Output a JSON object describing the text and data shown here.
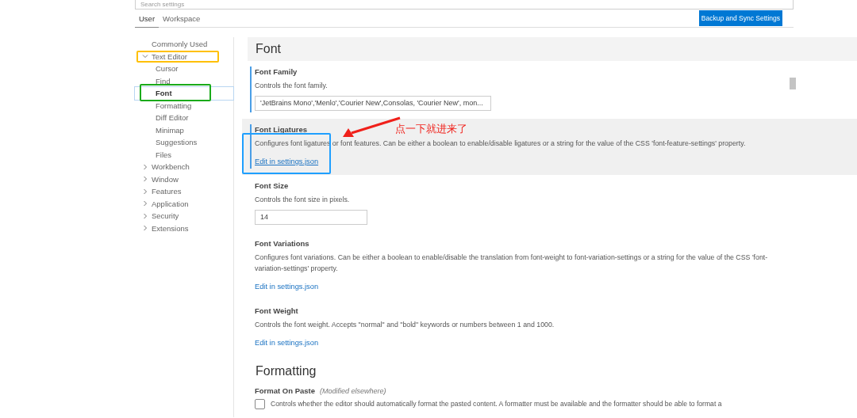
{
  "search": {
    "placeholder": "Search settings"
  },
  "tabs": [
    {
      "label": "User",
      "selected": true
    },
    {
      "label": "Workspace",
      "selected": false
    }
  ],
  "sync_button": "Backup and Sync Settings",
  "sidebar": {
    "items": [
      {
        "label": "Commonly Used",
        "selected": false
      },
      {
        "label": "Text Editor",
        "selected": false,
        "expanded": true,
        "children": [
          {
            "label": "Cursor",
            "selected": false
          },
          {
            "label": "Find",
            "selected": false
          },
          {
            "label": "Font",
            "selected": true
          },
          {
            "label": "Formatting",
            "selected": false
          },
          {
            "label": "Diff Editor",
            "selected": false
          },
          {
            "label": "Minimap",
            "selected": false
          },
          {
            "label": "Suggestions",
            "selected": false
          },
          {
            "label": "Files",
            "selected": false
          }
        ]
      },
      {
        "label": "Workbench",
        "selected": false,
        "expanded": false
      },
      {
        "label": "Window",
        "selected": false,
        "expanded": false
      },
      {
        "label": "Features",
        "selected": false,
        "expanded": false
      },
      {
        "label": "Application",
        "selected": false,
        "expanded": false
      },
      {
        "label": "Security",
        "selected": false,
        "expanded": false
      },
      {
        "label": "Extensions",
        "selected": false,
        "expanded": false
      }
    ]
  },
  "sections": [
    {
      "title": "Font",
      "settings": [
        {
          "kind": "text",
          "title": "Font Family",
          "description": "Controls the font family.",
          "value": "'JetBrains Mono','Menlo','Courier New',Consolas, 'Courier New', mon...",
          "modified": true,
          "focused": false
        },
        {
          "kind": "link",
          "title": "Font Ligatures",
          "description": "Configures font ligatures or font features. Can be either a boolean to enable/disable ligatures or a string for the value of the CSS 'font-feature-settings' property.",
          "link": "Edit in settings.json",
          "modified": true,
          "focused": true
        },
        {
          "kind": "number",
          "title": "Font Size",
          "description": "Controls the font size in pixels.",
          "value": "14",
          "modified": false,
          "focused": false
        },
        {
          "kind": "link",
          "title": "Font Variations",
          "description": "Configures font variations. Can be either a boolean to enable/disable the translation from font-weight to font-variation-settings or a string for the value of the CSS 'font-variation-settings' property.",
          "link": "Edit in settings.json",
          "modified": false,
          "focused": false
        },
        {
          "kind": "link",
          "title": "Font Weight",
          "description": "Controls the font weight. Accepts \"normal\" and \"bold\" keywords or numbers between 1 and 1000.",
          "link": "Edit in settings.json",
          "modified": false,
          "focused": false
        }
      ]
    },
    {
      "title": "Formatting",
      "settings": [
        {
          "kind": "checkbox",
          "title": "Format On Paste",
          "note": "(Modified elsewhere)",
          "description": "Controls whether the editor should automatically format the pasted content. A formatter must be available and the formatter should be able to format a",
          "checked": false,
          "modified": false,
          "focused": false
        }
      ]
    }
  ],
  "annotation": {
    "note": "点一下就进来了",
    "boxes": [
      {
        "color": "#ffc000"
      },
      {
        "color": "#1aaa1a"
      },
      {
        "color": "#1e9fff"
      }
    ]
  }
}
